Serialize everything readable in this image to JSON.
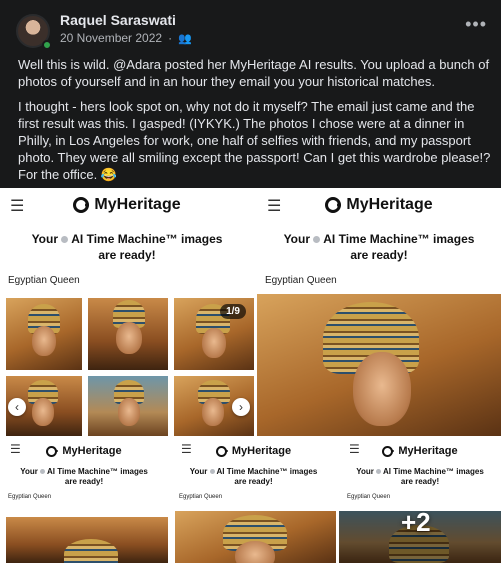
{
  "post": {
    "author": "Raquel Saraswati",
    "date": "20 November 2022",
    "audience_icon": "friends-icon",
    "more_label": "•••",
    "paragraphs": [
      "Well this is wild. @Adara posted her MyHeritage AI results. You upload a bunch of photos of yourself and in an hour they email you your historical matches.",
      "I thought - hers look spot on, why not do it myself? The email just came and the first result was this. I gasped! (IYKYK.) The photos I chose were at a dinner in Philly, in Los Angeles for work, one half of selfies with friends, and my passport photo. They were all smiling except the passport! Can I get this wardrobe please!? For the office. 😂"
    ]
  },
  "tiles": [
    {
      "brand": "MyHeritage",
      "headline_1": "Your",
      "headline_2": "AI Time Machine™ images",
      "headline_3": "are ready!",
      "label": "Egyptian Queen",
      "pager": "1/9"
    },
    {
      "brand": "MyHeritage",
      "headline_1": "Your",
      "headline_2": "AI Time Machine™ images",
      "headline_3": "are ready!",
      "label": "Egyptian Queen"
    },
    {
      "brand": "MyHeritage",
      "headline_1": "Your",
      "headline_2": "AI Time Machine™ images",
      "headline_3": "are ready!",
      "label": "Egyptian Queen"
    },
    {
      "brand": "MyHeritage",
      "headline_1": "Your",
      "headline_2": "AI Time Machine™ images",
      "headline_3": "are ready!",
      "label": "Egyptian Queen"
    },
    {
      "brand": "MyHeritage",
      "headline_1": "Your",
      "headline_2": "AI Time Machine™ images",
      "headline_3": "are ready!",
      "label": "Egyptian Queen",
      "more_count": "+2"
    }
  ],
  "icons": {
    "menu": "☰",
    "prev": "‹",
    "next": "›"
  },
  "colors": {
    "post_bg": "#18191a",
    "online": "#31a24c",
    "text": "#e4e6eb",
    "muted": "#b0b3b8"
  }
}
